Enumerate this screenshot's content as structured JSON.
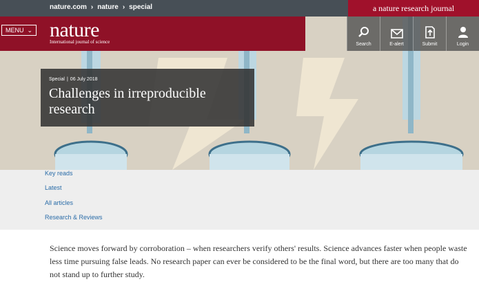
{
  "breadcrumb": [
    "nature.com",
    "nature",
    "special"
  ],
  "journal_badge": "a nature research journal",
  "menu_label": "MENU",
  "logo": {
    "name": "nature",
    "tagline": "International journal of science"
  },
  "actions": [
    {
      "label": "Search",
      "icon": "search-icon"
    },
    {
      "label": "E-alert",
      "icon": "envelope-icon"
    },
    {
      "label": "Submit",
      "icon": "upload-document-icon"
    },
    {
      "label": "Login",
      "icon": "user-icon"
    }
  ],
  "article": {
    "type": "Special",
    "date": "06 July 2018",
    "title": "Challenges in irreproducible research"
  },
  "subnav": [
    "Key reads",
    "Latest",
    "All articles",
    "Research & Reviews"
  ],
  "intro": "Science moves forward by corroboration – when researchers verify others' results. Science advances faster when people waste less time pursuing false leads. No research paper can ever be considered to be the final word, but there are too many that do not stand up to further study.",
  "colors": {
    "brand_red": "#8f1127",
    "topbar": "#474f56",
    "link": "#2a6ca8"
  }
}
